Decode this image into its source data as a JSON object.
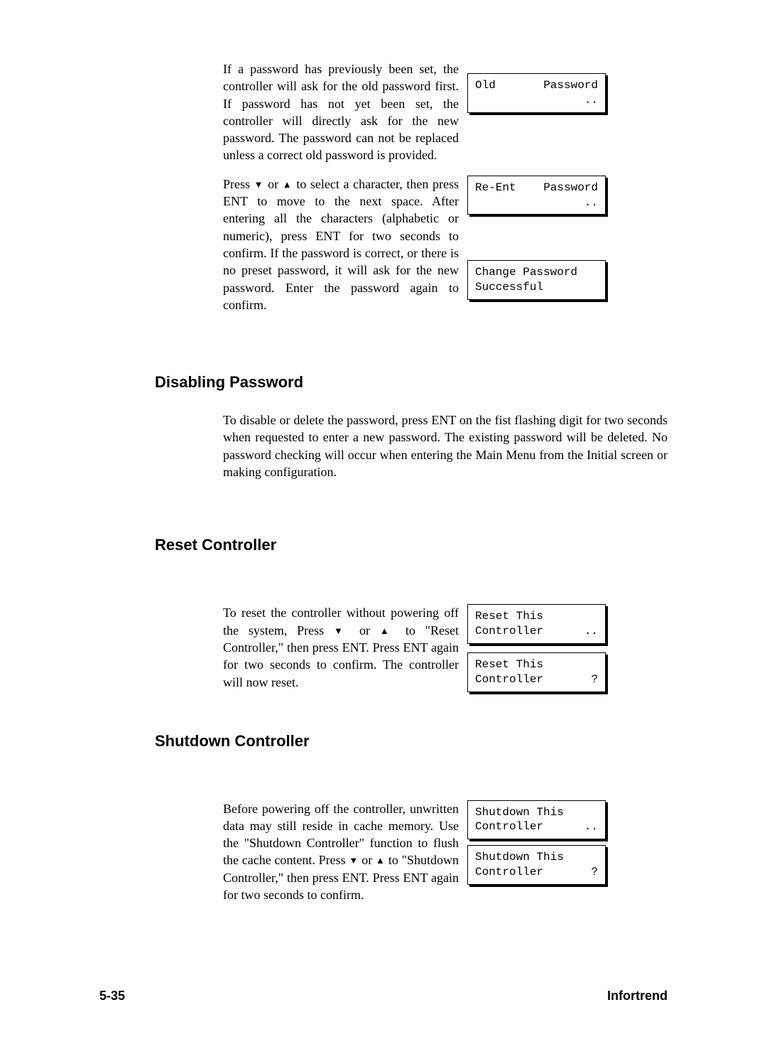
{
  "sect1": {
    "p1": "If a password has previously been set, the controller will ask for the old password first.  If password has not yet been set, the controller will directly ask for the new password.  The password can not be replaced unless a correct old password is provided.",
    "p2_pre": "Press ",
    "p2_mid": " or ",
    "p2_post": " to select a character, then press ENT to move to the next space. After entering all the characters (alphabetic or numeric), press ENT for two seconds to confirm.  If the password is correct, or there is no preset password, it will ask for the new password.  Enter the password again to confirm.",
    "lcd1a": "Old",
    "lcd1b": "Password",
    "lcd1c": "..",
    "lcd2a": "Re-Ent",
    "lcd2b": "Password",
    "lcd2c": "..",
    "lcd3a": "Change Password",
    "lcd3b": "Successful"
  },
  "disable": {
    "title": "Disabling Password",
    "p": "To disable or delete the password, press ENT on the fist flashing digit for two seconds when requested to enter a new password.  The existing password will be deleted.  No password checking will occur when entering the Main Menu from the Initial screen or making configuration."
  },
  "reset": {
    "title": "Reset Controller",
    "p_a": "To reset the controller without powering off the system, Press ",
    "p_mid": " or ",
    "p_b": " to \"Reset Controller,\" then press ENT.  Press ENT again for two seconds to confirm. The controller will now reset.",
    "lcd1a": "Reset This",
    "lcd1b": "Controller",
    "lcd1c": "..",
    "lcd2a": "Reset This",
    "lcd2b": "Controller",
    "lcd2c": " ?"
  },
  "shutdown": {
    "title": "Shutdown Controller",
    "p_a": "Before powering off the controller, unwritten data may still reside in cache memory.  Use the \"Shutdown Controller\" function to flush the cache content.  Press ",
    "p_mid": " or ",
    "p_b": " to \"Shutdown Controller,\" then press ENT.  Press ENT again for two seconds to confirm.",
    "lcd1a": "Shutdown This",
    "lcd1b": "Controller",
    "lcd1c": "..",
    "lcd2a": "Shutdown This",
    "lcd2b": "Controller",
    "lcd2c": " ?"
  },
  "footer": {
    "left": "5-35",
    "right": "Infortrend"
  },
  "icons": {
    "down": "▼",
    "up": "▲"
  }
}
